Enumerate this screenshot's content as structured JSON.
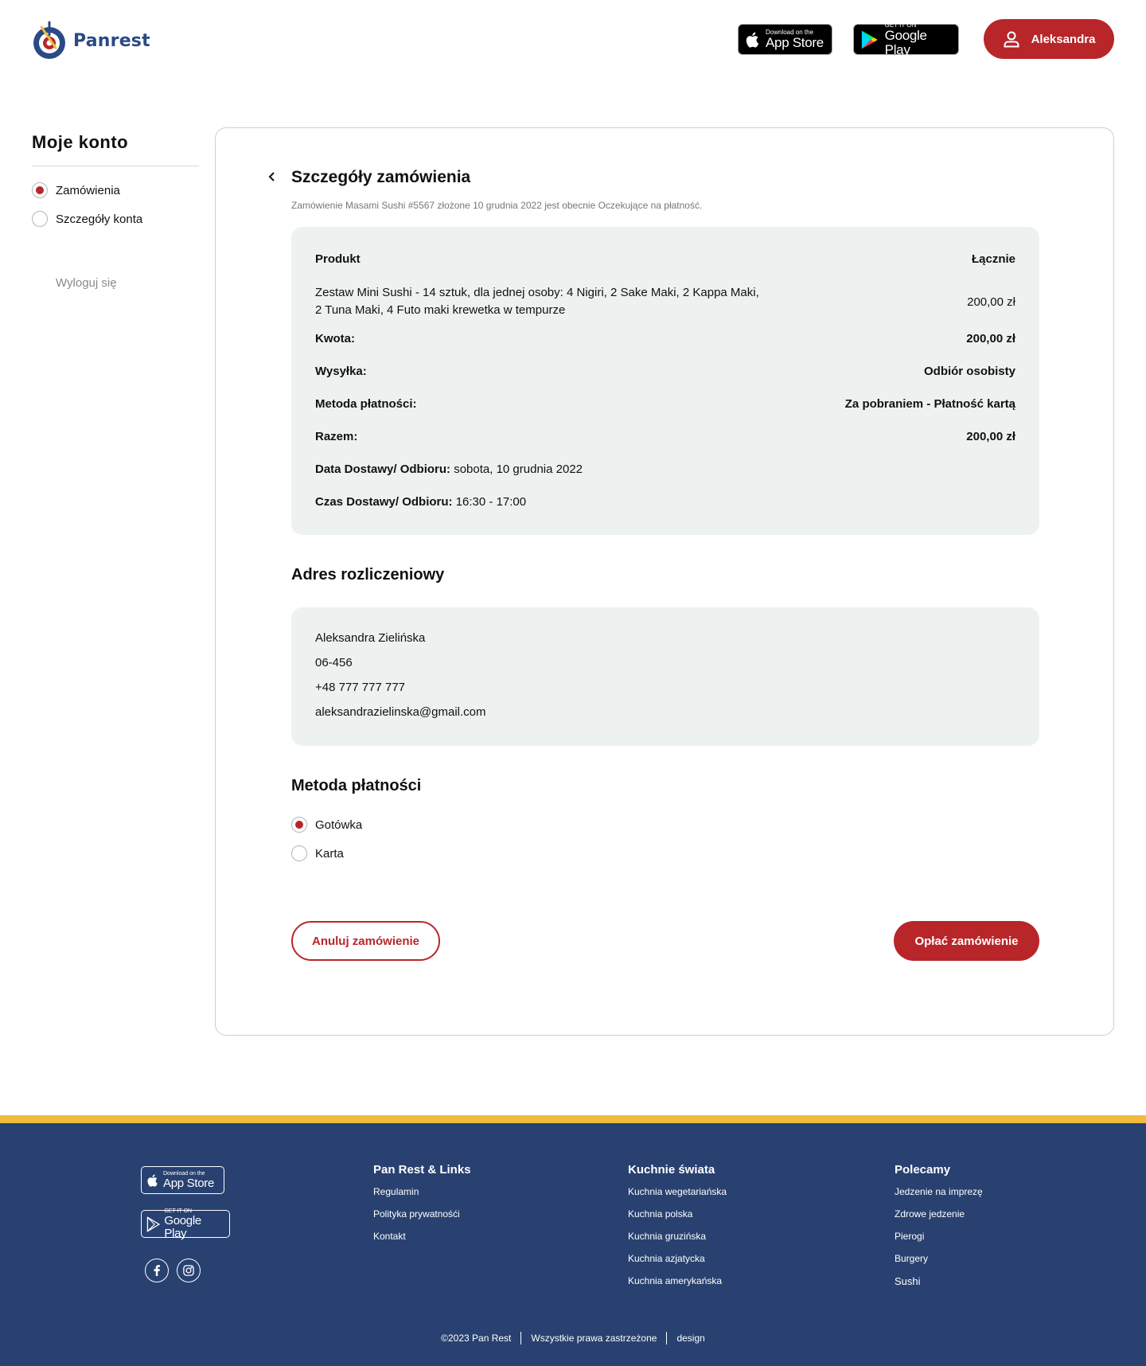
{
  "header": {
    "logo_text": "Panrest",
    "app_store": {
      "small": "Download on the",
      "big": "App Store"
    },
    "google_play": {
      "small": "GET IT ON",
      "big": "Google Play"
    },
    "user_name": "Aleksandra",
    "accent": "#b8262a"
  },
  "sidebar": {
    "title": "Moje konto",
    "items": [
      {
        "label": "Zamówienia",
        "selected": true
      },
      {
        "label": "Szczegóły konta",
        "selected": false
      }
    ],
    "logout": "Wyloguj się"
  },
  "order": {
    "title": "Szczegóły zamówienia",
    "subtitle": "Zamówienie Masami Sushi #5567 złożone 10 grudnia 2022 jest obecnie Oczekujące na płatność.",
    "header_product": "Produkt",
    "header_total": "Łącznie",
    "product_line1": "Zestaw Mini Sushi - 14 sztuk, dla jednej osoby: 4 Nigiri, 2 Sake Maki, 2 Kappa Maki,",
    "product_line2": "2 Tuna Maki, 4 Futo maki krewetka w tempurze",
    "product_price": "200,00 zł",
    "amount_label": "Kwota:",
    "amount_value": "200,00 zł",
    "shipping_label": "Wysyłka:",
    "shipping_value": "Odbiór osobisty",
    "payment_label": "Metoda płatności:",
    "payment_value": "Za pobraniem - Płatność kartą",
    "total_label": "Razem:",
    "total_value": "200,00 zł",
    "date_label": "Data Dostawy/ Odbioru:",
    "date_value": "sobota, 10 grudnia 2022",
    "time_label": "Czas Dostawy/ Odbioru:",
    "time_value": "16:30 - 17:00"
  },
  "billing": {
    "title": "Adres rozliczeniowy",
    "name": "Aleksandra Zielińska",
    "postal": "06-456",
    "phone": "+48 777 777 777",
    "email": "aleksandrazielinska@gmail.com"
  },
  "payment_method": {
    "title": "Metoda płatności",
    "options": [
      {
        "label": "Gotówka",
        "selected": true
      },
      {
        "label": "Karta",
        "selected": false
      }
    ]
  },
  "actions": {
    "cancel": "Anuluj zamówienie",
    "pay": "Opłać zamówienie"
  },
  "footer": {
    "app_store": {
      "small": "Download on the",
      "big": "App Store"
    },
    "google_play": {
      "small": "GET IT ON",
      "big": "Google Play"
    },
    "col1": {
      "title": "Pan Rest & Links",
      "links": [
        "Regulamin",
        "Polityka prywatnośći",
        "Kontakt"
      ]
    },
    "col2": {
      "title": "Kuchnie świata",
      "links": [
        "Kuchnia wegetariańska",
        "Kuchnia polska",
        "Kuchnia gruzińska",
        "Kuchnia azjatycka",
        "Kuchnia amerykańska"
      ]
    },
    "col3": {
      "title": "Polecamy",
      "links": [
        "Jedzenie na imprezę",
        "Zdrowe jedzenie",
        "Pierogi",
        "Burgery",
        "Sushi"
      ]
    },
    "copyright": "©2023 Pan Rest",
    "rights": "Wszystkie prawa zastrzeżone",
    "design": "design",
    "background": "#284170",
    "stripe": "#f0bb3e"
  }
}
